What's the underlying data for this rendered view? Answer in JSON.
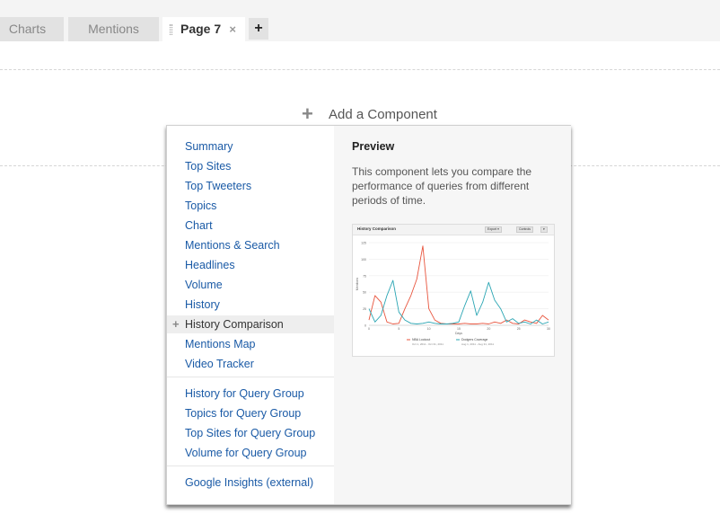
{
  "tabs": [
    {
      "label": "Charts"
    },
    {
      "label": "Mentions"
    },
    {
      "label": "Page 7",
      "active": true
    }
  ],
  "tab_close_glyph": "×",
  "add_tab_glyph": "+",
  "add_component": {
    "label": "Add a Component",
    "icon": "plus-icon"
  },
  "menu": {
    "groups": [
      [
        {
          "label": "Summary"
        },
        {
          "label": "Top Sites"
        },
        {
          "label": "Top Tweeters"
        },
        {
          "label": "Topics"
        },
        {
          "label": "Chart"
        },
        {
          "label": "Mentions & Search"
        },
        {
          "label": "Headlines"
        },
        {
          "label": "Volume"
        },
        {
          "label": "History"
        },
        {
          "label": "History Comparison",
          "hover": true
        },
        {
          "label": "Mentions Map"
        },
        {
          "label": "Video Tracker"
        }
      ],
      [
        {
          "label": "History for Query Group"
        },
        {
          "label": "Topics for Query Group"
        },
        {
          "label": "Top Sites for Query Group"
        },
        {
          "label": "Volume for Query Group"
        }
      ],
      [
        {
          "label": "Google Insights (external)"
        }
      ]
    ]
  },
  "preview": {
    "title": "Preview",
    "description": "This component lets you compare the performance of queries from different periods of time.",
    "thumbnail": {
      "title": "History Comparison",
      "buttons": [
        "Export ▾",
        "Controls",
        "▾"
      ],
      "x_ticks": [
        "0",
        "5",
        "10",
        "15",
        "20",
        "25",
        "30"
      ],
      "y_ticks": [
        "0",
        "25",
        "50",
        "75",
        "100",
        "125"
      ],
      "x_label": "Days",
      "y_label": "Mentions",
      "legend": [
        {
          "name": "NBA Lockout",
          "range": "Oct 1, 2011 - Oct 31, 2011",
          "color": "#e8553e"
        },
        {
          "name": "Dodgers Coverage",
          "range": "Aug 1, 2011 - Aug 31, 2011",
          "color": "#2aa5b3"
        }
      ],
      "series": [
        {
          "name": "NBA Lockout",
          "color": "#e8553e",
          "values": [
            8,
            45,
            35,
            5,
            2,
            3,
            25,
            45,
            70,
            120,
            25,
            8,
            3,
            2,
            2,
            2,
            3,
            2,
            2,
            3,
            2,
            5,
            3,
            8,
            3,
            2,
            8,
            5,
            3,
            15,
            8
          ]
        },
        {
          "name": "Dodgers Coverage",
          "color": "#2aa5b3",
          "values": [
            25,
            5,
            15,
            45,
            68,
            20,
            8,
            3,
            2,
            3,
            5,
            3,
            2,
            2,
            3,
            5,
            30,
            52,
            15,
            35,
            65,
            38,
            25,
            5,
            10,
            3,
            5,
            2,
            8,
            2,
            5
          ]
        }
      ],
      "ylim": [
        0,
        125
      ],
      "xlim": [
        0,
        30
      ]
    }
  }
}
